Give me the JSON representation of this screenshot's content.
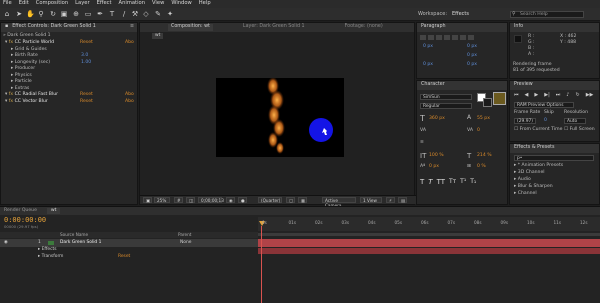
{
  "menu": [
    "File",
    "Edit",
    "Composition",
    "Layer",
    "Effect",
    "Animation",
    "View",
    "Window",
    "Help"
  ],
  "toolbar": {
    "workspace_label": "Workspace:",
    "workspace_value": "Effects",
    "search_placeholder": "Search Help"
  },
  "effect_controls": {
    "tab": "Effect Controls: Dark Green Solid 1",
    "subtitle": "» Dark Green Solid 1",
    "effects": [
      {
        "name": "CC Particle World",
        "reset": "Reset",
        "about": "Abo"
      },
      {
        "name": "Grid & Guides"
      },
      {
        "name": "Birth Rate",
        "value": "3.0"
      },
      {
        "name": "Longevity (sec)",
        "value": "1.00"
      },
      {
        "name": "Producer"
      },
      {
        "name": "Physics"
      },
      {
        "name": "Particle"
      },
      {
        "name": "Extras"
      },
      {
        "name": "CC Radial Fast Blur",
        "reset": "Reset",
        "about": "Abo"
      },
      {
        "name": "CC Vector Blur",
        "reset": "Reset",
        "about": "Abo"
      }
    ]
  },
  "composition": {
    "tab": "Composition: wt",
    "layer_tab": "Layer: Dark Green Solid 1",
    "footage_tab": "Footage: (none)",
    "comp_name": "wt",
    "zoom": "25%",
    "timecode": "0;00;00;13",
    "resolution": "(Quarter)",
    "camera": "Active Camera",
    "views": "1 View"
  },
  "info": {
    "tab": "Info",
    "r": "R :",
    "g": "G :",
    "b": "B :",
    "a": "A :",
    "x": "X : 462",
    "y": "Y : 488",
    "rendering": "Rendering frame",
    "requested": "81 of 395 requested"
  },
  "paragraph": {
    "tab": "Paragraph",
    "values": [
      "0 px",
      "0 px",
      "0 px",
      "0 px",
      "0 px"
    ]
  },
  "character": {
    "tab": "Character",
    "font": "SimSun",
    "style": "Regular",
    "size": "360 px",
    "leading": "55 px",
    "kerning": "",
    "tracking": "0",
    "vscale": "100 %",
    "hscale": "214 %",
    "baseline": "0 px",
    "tsume": "0 %"
  },
  "preview": {
    "tab": "Preview",
    "preset": "RAM Preview Options",
    "frame_rate_label": "Frame Rate",
    "skip_label": "Skip",
    "resolution_label": "Resolution",
    "frame_rate": "(29.97)",
    "skip": "0",
    "resolution": "Auto",
    "from_current": "From Current Time",
    "full_screen": "Full Screen"
  },
  "effects_presets": {
    "tab": "Effects & Presets",
    "search_placeholder": "p•",
    "items": [
      "* Animation Presets",
      "3D Channel",
      "Audio",
      "Blur & Sharpen",
      "Channel"
    ]
  },
  "timeline": {
    "render_tab": "Render Queue",
    "comp_tab": "wt",
    "timecode": "0:00:00:00",
    "fps": "00000 (29.97 fps)",
    "source_col": "Source Name",
    "parent_col": "Parent",
    "layer_num": "1",
    "layer_name": "Dark Green Solid 1",
    "parent_value": "None",
    "sub_effects": "Effects",
    "sub_transform": "Transform",
    "reset": "Reset",
    "ticks": [
      "0s",
      "01s",
      "02s",
      "03s",
      "04s",
      "05s",
      "06s",
      "07s",
      "08s",
      "09s",
      "10s",
      "11s",
      "12s"
    ]
  }
}
